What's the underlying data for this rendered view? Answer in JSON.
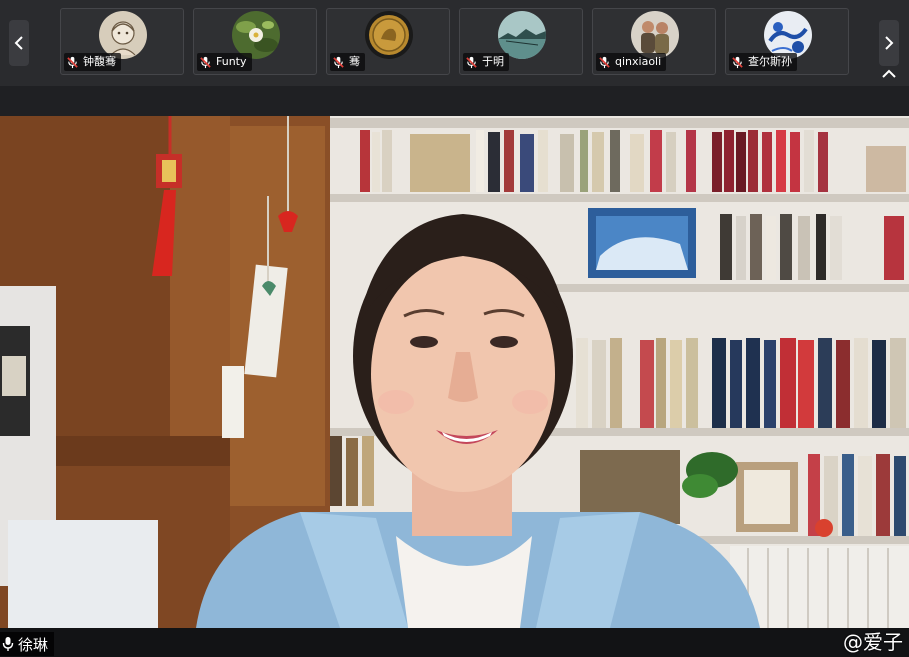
{
  "participants": [
    {
      "name": "钟馥骞",
      "icon": "microphone-muted-icon"
    },
    {
      "name": "Funty",
      "icon": "microphone-muted-icon"
    },
    {
      "name": "骞",
      "icon": "microphone-muted-icon"
    },
    {
      "name": "于明",
      "icon": "microphone-muted-icon"
    },
    {
      "name": "qinxiaoli",
      "icon": "microphone-muted-icon"
    },
    {
      "name": "查尔斯孙",
      "icon": "microphone-muted-icon"
    }
  ],
  "speaker": {
    "name": "徐琳",
    "icon": "microphone-icon"
  },
  "watermark": "@爱子",
  "colors": {
    "muted_icon": "#e0403a",
    "topbar": "#2a2b2e"
  }
}
